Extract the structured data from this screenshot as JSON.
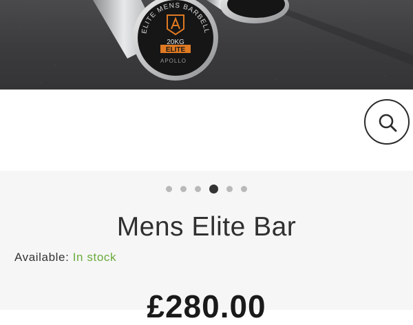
{
  "product": {
    "image_alt": "Apollo Elite Mens Barbell",
    "sleeve_label": {
      "arc_text": "ELITE MENS BARBELL",
      "weight": "20KG",
      "grade": "ELITE",
      "brand": "APOLLO"
    },
    "title": "Mens Elite Bar",
    "availability_label": "Available:",
    "availability_status": "In stock",
    "price": "£280.00"
  },
  "gallery": {
    "slide_count": 6,
    "active_slide": 4
  },
  "icons": {
    "zoom": "search-icon",
    "brand": "apollo-logo-icon"
  },
  "colors": {
    "in_stock": "#6aab3c",
    "label_orange": "#e07a22",
    "active_dot": "#333333",
    "inactive_dot": "#b9b9b9"
  }
}
